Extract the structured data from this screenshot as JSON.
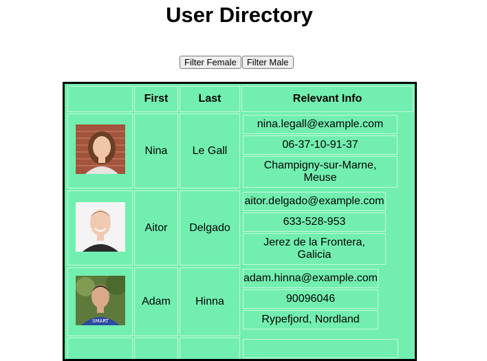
{
  "title": "User Directory",
  "filters": {
    "female_label": "Filter Female",
    "male_label": "Filter Male"
  },
  "table": {
    "headers": [
      "",
      "First",
      "Last",
      "Relevant Info"
    ],
    "rows": [
      {
        "first": "Nina",
        "last": "Le Gall",
        "email": "nina.legall@example.com",
        "phone": "06-37-10-91-37",
        "location": "Champigny-sur-Marne, Meuse"
      },
      {
        "first": "Aitor",
        "last": "Delgado",
        "email": "aitor.delgado@example.com",
        "phone": "633-528-953",
        "location": "Jerez de la Frontera, Galicia"
      },
      {
        "first": "Adam",
        "last": "Hinna",
        "email": "adam.hinna@example.com",
        "phone": "90096046",
        "location": "Rypefjord, Nordland"
      }
    ]
  },
  "colors": {
    "table_bg": "#72efb0",
    "cell_border": "#c8f7dd",
    "outer_border": "#000000"
  }
}
